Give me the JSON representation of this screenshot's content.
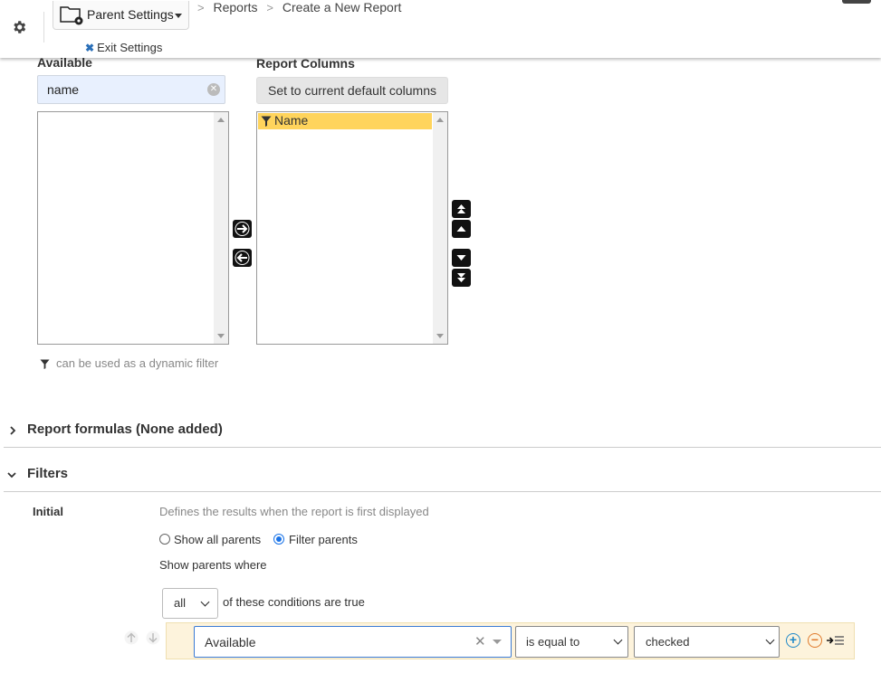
{
  "header": {
    "parent_settings_label": "Parent Settings",
    "exit_settings_label": "Exit Settings",
    "breadcrumb": [
      "Reports",
      "Create a New Report"
    ],
    "breadcrumb_sep": ">"
  },
  "columns": {
    "available_label": "Available",
    "search_value": "name",
    "report_columns_label": "Report Columns",
    "set_default_label": "Set to current default columns",
    "report_columns": [
      "Name"
    ],
    "dynamic_filter_note": "can be used as a dynamic filter"
  },
  "sections": {
    "formulas_title": "Report formulas (None added)",
    "filters_title": "Filters"
  },
  "filters": {
    "initial_label": "Initial",
    "initial_description": "Defines the results when the report is first displayed",
    "radio_show_all": "Show all parents",
    "radio_filter": "Filter parents",
    "selected_radio": "Filter parents",
    "show_where": "Show parents where",
    "match_value": "all",
    "match_suffix": "of these conditions are true",
    "condition": {
      "field": "Available",
      "operator": "is equal to",
      "value": "checked"
    }
  },
  "colors": {
    "highlight": "#ffd45c",
    "condition_bg": "#fdf3dc",
    "search_bg": "#e8f0fe",
    "accent_blue": "#1a73e8"
  }
}
